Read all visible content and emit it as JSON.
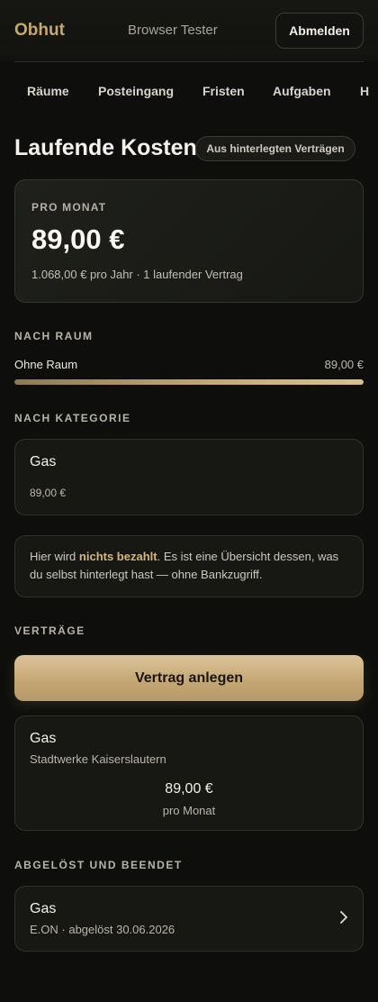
{
  "header": {
    "brand": "Obhut",
    "user": "Browser Tester",
    "logout_label": "Abmelden"
  },
  "nav": {
    "items": [
      "Räume",
      "Posteingang",
      "Fristen",
      "Aufgaben",
      "H"
    ]
  },
  "page": {
    "title": "Laufende Kosten",
    "source_badge": "Aus hinterlegten Verträgen"
  },
  "summary": {
    "label": "PRO MONAT",
    "amount": "89,00 €",
    "sub": "1.068,00 € pro Jahr · 1 laufender Vertrag"
  },
  "by_room": {
    "title": "NACH RAUM",
    "rows": [
      {
        "label": "Ohne Raum",
        "value": "89,00 €",
        "share": 1.0
      }
    ]
  },
  "by_category": {
    "title": "NACH KATEGORIE",
    "items": [
      {
        "name": "Gas",
        "value": "89,00 €"
      }
    ]
  },
  "info": {
    "prefix": "Hier wird ",
    "highlight": "nichts bezahlt",
    "suffix": ". Es ist eine Übersicht dessen, was du selbst hinterlegt hast — ohne Bankzugriff."
  },
  "contracts": {
    "title": "VERTRÄGE",
    "add_label": "Vertrag anlegen",
    "items": [
      {
        "name": "Gas",
        "provider": "Stadtwerke Kaiserslautern",
        "amount": "89,00 €",
        "period": "pro Monat"
      }
    ]
  },
  "ended": {
    "title": "ABGELÖST UND BEENDET",
    "items": [
      {
        "name": "Gas",
        "sub": "E.ON · abgelöst 30.06.2026"
      }
    ]
  },
  "colors": {
    "accent": "#c8a86e",
    "background": "#0e0f0c",
    "card": "#171814"
  }
}
